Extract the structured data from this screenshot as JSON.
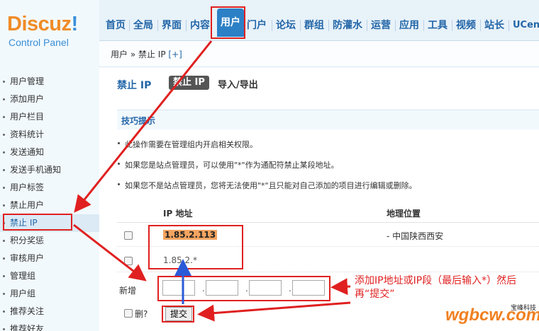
{
  "logo": {
    "brand_orange": "Discuz",
    "brand_bang": "!",
    "subtitle": "Control Panel"
  },
  "topnav": {
    "tabs": [
      "首页",
      "全局",
      "界面",
      "内容",
      "用户",
      "门户",
      "论坛",
      "群组",
      "防灌水",
      "运营",
      "应用",
      "工具",
      "视频",
      "站长",
      "UCent"
    ],
    "active_tab": "用户"
  },
  "breadcrumb": {
    "path": "用户 » 禁止 IP",
    "add": "[+]"
  },
  "sidebar": {
    "items": [
      "用户管理",
      "添加用户",
      "用户栏目",
      "资料统计",
      "发送通知",
      "发送手机通知",
      "用户标签",
      "禁止用户",
      "禁止 IP",
      "积分奖惩",
      "审核用户",
      "管理组",
      "用户组",
      "推荐关注",
      "推荐好友"
    ],
    "active_item": "禁止 IP"
  },
  "main": {
    "title": "禁止 IP",
    "tab_active": "禁止 IP",
    "tab_other": "导入/导出",
    "tips_title": "技巧提示",
    "tips": [
      "此操作需要在管理组内开启相关权限。",
      "如果您是站点管理员，可以使用\"*\"作为通配符禁止某段地址。",
      "如果您不是站点管理员，您将无法使用\"*\"且只能对自己添加的项目进行编辑或删除。"
    ],
    "table": {
      "headers": [
        "IP 地址",
        "地理位置"
      ],
      "rows": [
        {
          "ip": "1.85.2.113",
          "location": "- 中国陕西西安"
        },
        {
          "ip": "1.85.2.*",
          "location": ""
        }
      ]
    },
    "new_label": "新增",
    "delete_label": "删?",
    "submit_label": "提交"
  },
  "annotation": {
    "text": "添加IP地址或IP段（最后输入*）然后再“提交”",
    "color": "#e02020"
  },
  "watermark": {
    "site": "wgbcw.com",
    "name": "宝峰科技"
  },
  "colors": {
    "accent": "#2c80c6",
    "link": "#2366a8",
    "highlight": "#f4a460",
    "annotation": "#e02020"
  }
}
